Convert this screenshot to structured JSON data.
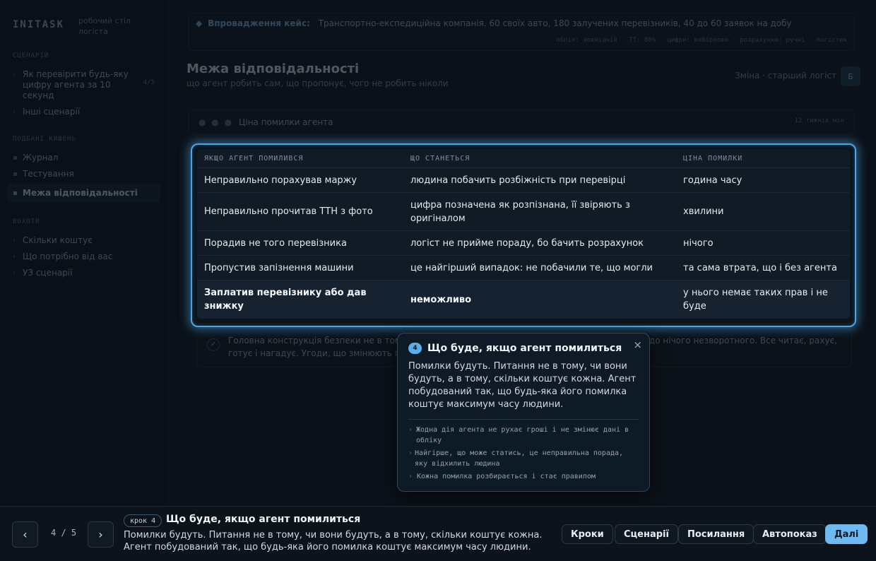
{
  "sidebar": {
    "brand": "INITASK",
    "brand_sub": "робочий стіл логіста",
    "sections": [
      "Сценарій",
      "Подбані кишень",
      "Вохоти"
    ],
    "items": [
      {
        "label": "Як перевірити будь-яку цифру агента за 10 секунд",
        "count": "4/5"
      },
      {
        "label": "Інші сценарії"
      },
      {
        "label": "Журнал"
      },
      {
        "label": "Тестування"
      },
      {
        "label": "Межа відповідальності"
      },
      {
        "label": "Скільки коштує"
      },
      {
        "label": "Що потрібно від вас"
      },
      {
        "label": "УЗ сценарії"
      }
    ]
  },
  "context": {
    "label": "Впровадження кейс:",
    "text": "Транспортно-експедиційна компанія. 60 своїх авто, 180 залучених перевізників, 40 до 60 заявок на добу",
    "tags": "облік: зовнішній · ТТ: 80% · цифри: вибірково · розрахунки: ручні · логістик"
  },
  "page": {
    "title": "Межа відповідальності",
    "subtitle": "що агент робить сам, що пропонує, чого не робить ніколи",
    "role": "Зміна · старший логіст",
    "avatar": "Б"
  },
  "chain": {
    "label": "Ціна помилки агента",
    "meta": "12 тижнів мін"
  },
  "table": {
    "headers": [
      "Якщо агент помилився",
      "Що станеться",
      "Ціна помилки"
    ],
    "rows": [
      [
        "Неправильно порахував маржу",
        "людина побачить розбіжність при перевірці",
        "година часу"
      ],
      [
        "Неправильно прочитав ТТН з фото",
        "цифра позначена як розпізнана, її звіряють з оригіналом",
        "хвилини"
      ],
      [
        "Порадив не того перевізника",
        "логіст не прийме пораду, бо бачить розрахунок",
        "нічого"
      ],
      [
        "Пропустив запізнення машини",
        "це найгірший випадок: не побачили те, що могли",
        "та сама втрата, що і без агента"
      ],
      [
        "Заплатив перевізнику або дав знижку",
        "неможливо",
        "у нього немає таких прав і не буде"
      ]
    ]
  },
  "note": {
    "text": "Головна конструкція безпеки не в тому, що агент розумний, а в тому, що він не має доступу до нічого незворотного. Все читає, рахує, готує і нагадує. Угоди, що змінюють гроші або облік, підтверджує лише людина."
  },
  "popover": {
    "step": "4",
    "title": "Що буде, якщо агент помилиться",
    "text": "Помилки будуть. Питання не в тому, чи вони будуть, а в тому, скільки коштує кожна. Агент побудований так, що будь-яка його помилка коштує максимум часу людини.",
    "bullets": [
      "Жодна дія агента не рухає гроші і не змінює дані в обліку",
      "Найгірше, що може статись, це неправильна порада, яку відхилить людина",
      "Кожна помилка розбирається і стає правилом"
    ],
    "close": "×"
  },
  "bottom": {
    "counter": "4 / 5",
    "step_badge": "крок 4",
    "title": "Що буде, якщо агент помилиться",
    "desc": "Помилки будуть. Питання не в тому, чи вони будуть, а в тому, скільки коштує кожна. Агент побудований так, що будь-яка його помилка коштує максимум часу людини.",
    "prev": "‹",
    "next": "›",
    "buttons": [
      "Кроки",
      "Сценарії",
      "Посилання",
      "Автопоказ"
    ],
    "primary": "Далі"
  },
  "colors": {
    "accent": "#4aa6e6",
    "primary_button": "#6db9f0",
    "background": "#0b1118"
  }
}
